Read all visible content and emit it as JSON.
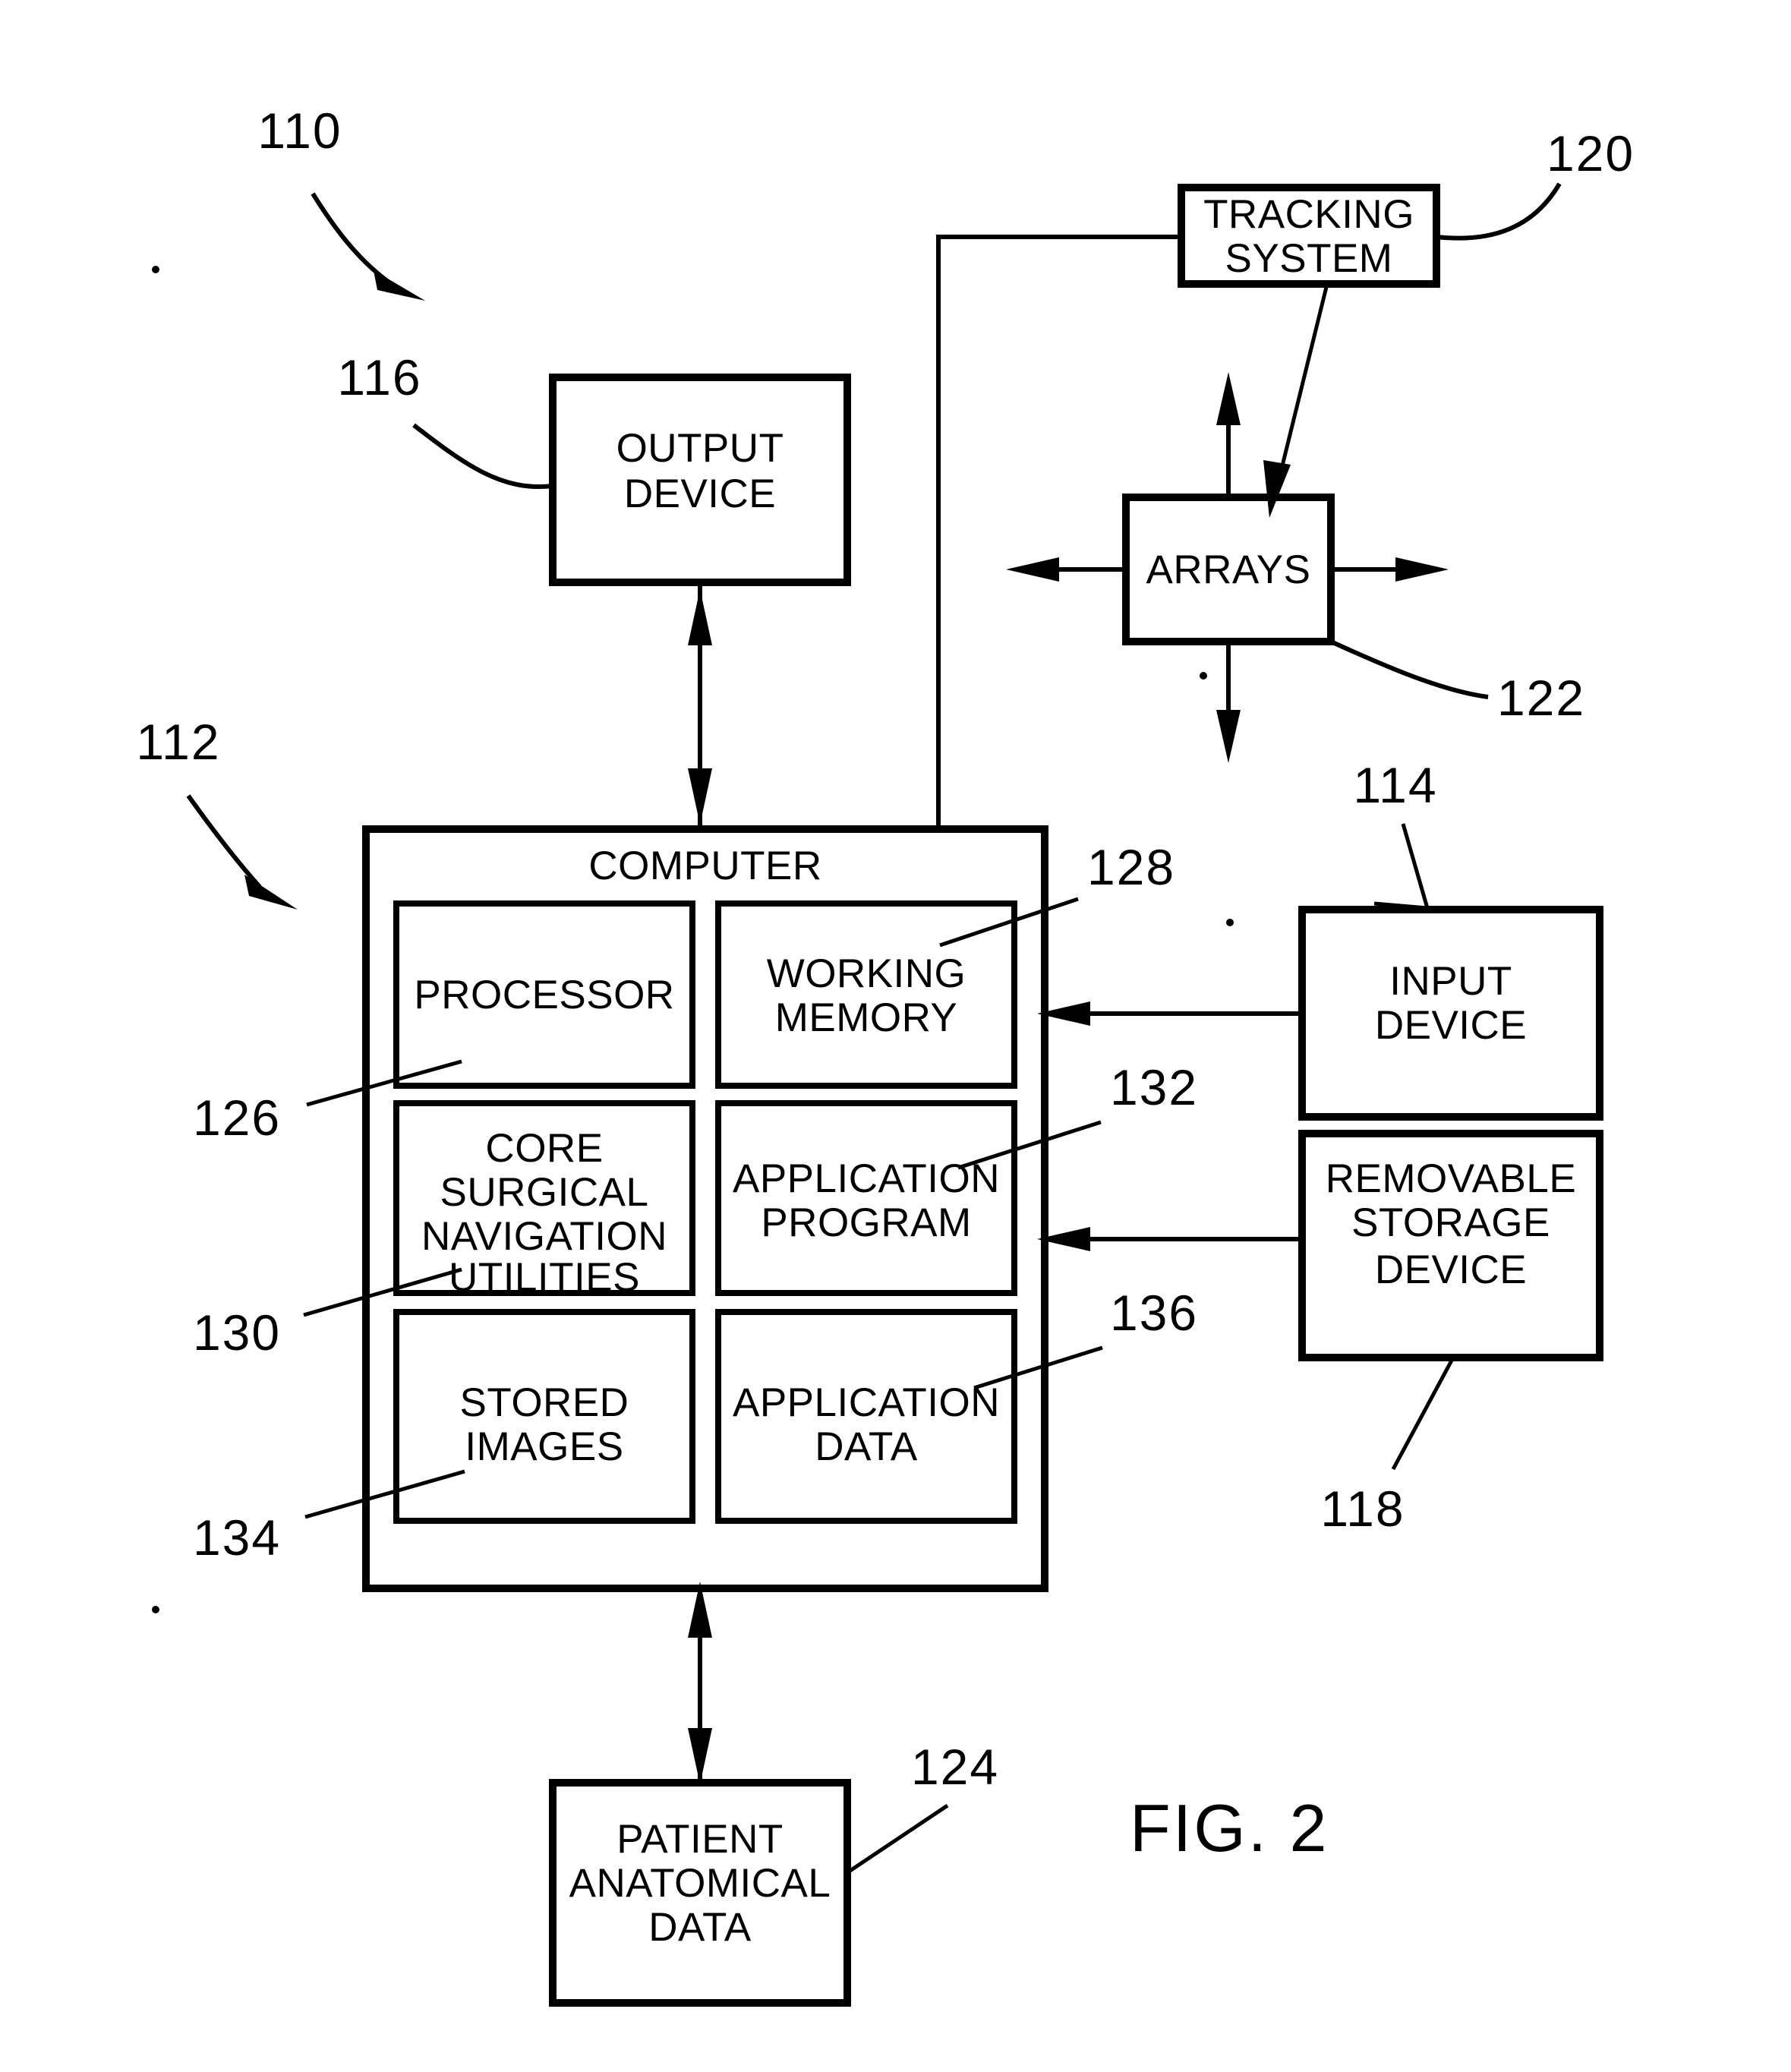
{
  "figure": {
    "caption": "FIG.  2",
    "title": "Surgical navigation system block diagram"
  },
  "boxes": {
    "tracking_system": {
      "label_line1": "TRACKING",
      "label_line2": "SYSTEM"
    },
    "arrays": {
      "label_line1": "ARRAYS"
    },
    "output_device": {
      "label_line1": "OUTPUT",
      "label_line2": "DEVICE"
    },
    "computer": {
      "label_line1": "COMPUTER"
    },
    "processor": {
      "label_line1": "PROCESSOR"
    },
    "working_memory": {
      "label_line1": "WORKING",
      "label_line2": "MEMORY"
    },
    "core_utilities": {
      "label_line1": "CORE",
      "label_line2": "SURGICAL",
      "label_line3": "NAVIGATION",
      "label_line4": "UTILITIES"
    },
    "application_program": {
      "label_line1": "APPLICATION",
      "label_line2": "PROGRAM"
    },
    "stored_images": {
      "label_line1": "STORED",
      "label_line2": "IMAGES"
    },
    "application_data": {
      "label_line1": "APPLICATION",
      "label_line2": "DATA"
    },
    "input_device": {
      "label_line1": "INPUT",
      "label_line2": "DEVICE"
    },
    "removable_storage": {
      "label_line1": "REMOVABLE",
      "label_line2": "STORAGE",
      "label_line3": "DEVICE"
    },
    "patient_data": {
      "label_line1": "PATIENT",
      "label_line2": "ANATOMICAL",
      "label_line3": "DATA"
    }
  },
  "reference_numerals": {
    "system": "110",
    "computer": "112",
    "input_device": "114",
    "output_device": "116",
    "removable_storage": "118",
    "tracking_system": "120",
    "arrays": "122",
    "patient_data": "124",
    "processor": "126",
    "working_memory": "128",
    "core_utilities": "130",
    "application_program": "132",
    "stored_images": "134",
    "application_data": "136"
  },
  "colors": {
    "stroke": "#000000",
    "fill": "#ffffff"
  }
}
